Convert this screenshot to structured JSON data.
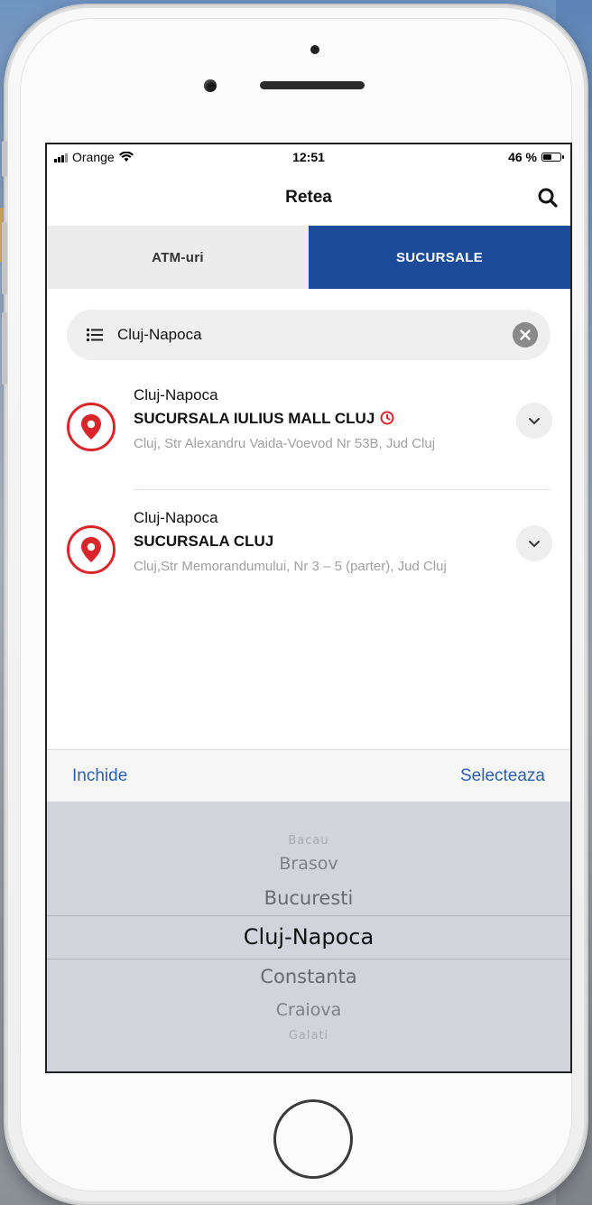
{
  "status_bar": {
    "carrier": "Orange",
    "time": "12:51",
    "battery": "46 %",
    "battery_level": 0.46
  },
  "header": {
    "title": "Retea"
  },
  "tabs": [
    {
      "label": "ATM-uri",
      "active": false
    },
    {
      "label": "SUCURSALE",
      "active": true
    }
  ],
  "filter": {
    "value": "Cluj-Napoca"
  },
  "branches": [
    {
      "city": "Cluj-Napoca",
      "name": "SUCURSALA IULIUS MALL CLUJ",
      "address": "Cluj, Str Alexandru Vaida-Voevod Nr 53B, Jud Cluj"
    },
    {
      "city": "Cluj-Napoca",
      "name": "SUCURSALA CLUJ",
      "address": "Cluj,Str Memorandumului, Nr 3 – 5 (parter), Jud Cluj"
    }
  ],
  "picker_toolbar": {
    "close_label": "Inchide",
    "select_label": "Selecteaza"
  },
  "picker": {
    "items": [
      "Bacau",
      "Brasov",
      "Bucuresti",
      "Cluj-Napoca",
      "Constanta",
      "Craiova",
      "Galati"
    ],
    "selected": "Cluj-Napoca"
  },
  "colors": {
    "accent": "#1c4b9a",
    "pin": "#d8262b",
    "link": "#2d5fb0"
  }
}
